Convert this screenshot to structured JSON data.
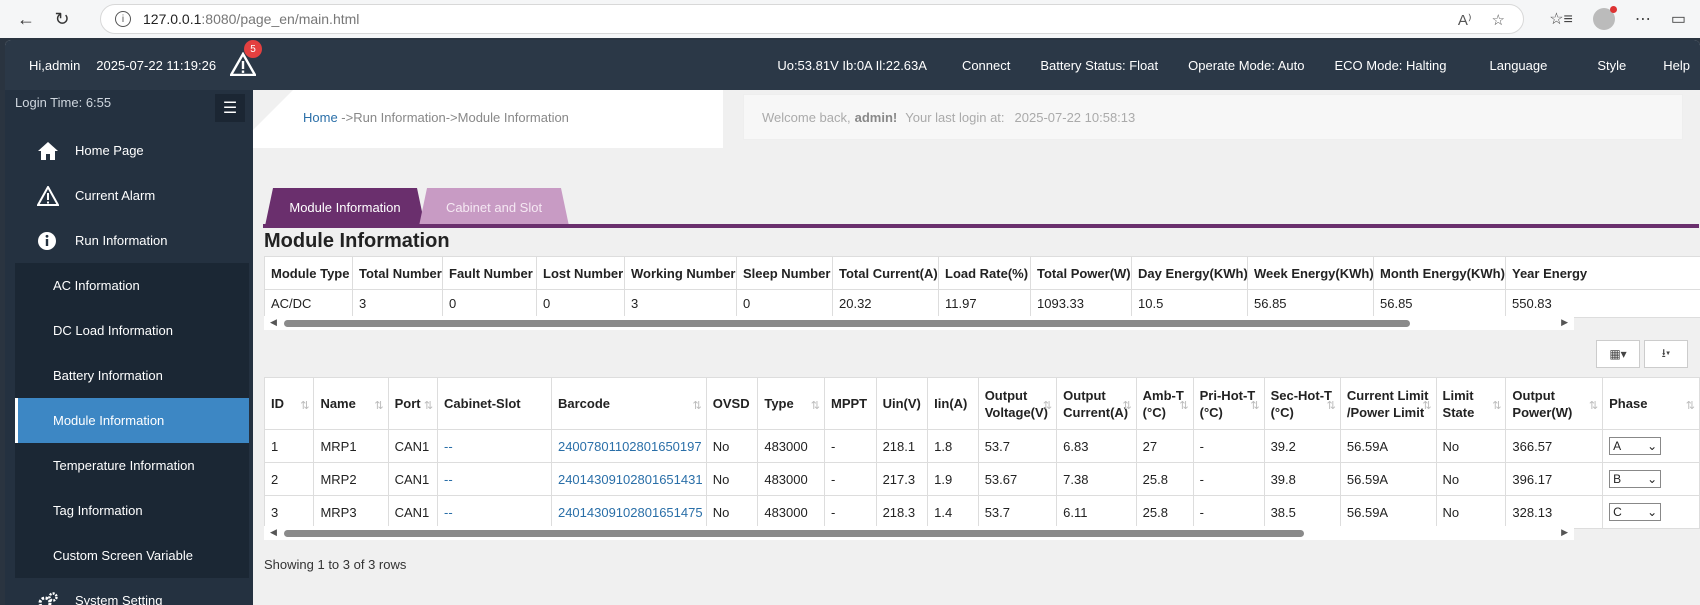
{
  "browser": {
    "url_host": "127.0.0.1",
    "url_rest": ":8080/page_en/main.html"
  },
  "topbar": {
    "greeting": "Hi,admin",
    "datetime": "2025-07-22 11:19:26",
    "alarm_count": "5",
    "readings": "Uo:53.81V Ib:0A Il:22.63A",
    "connect": "Connect",
    "battery_status": "Battery Status: Float",
    "operate_mode": "Operate Mode: Auto",
    "eco_mode": "ECO Mode: Halting",
    "language": "Language",
    "style": "Style",
    "help": "Help"
  },
  "sidebar": {
    "login_time": "Login Time:  6:55",
    "items": [
      {
        "label": "Home Page",
        "icon": "home-icon"
      },
      {
        "label": "Current Alarm",
        "icon": "warning-icon"
      },
      {
        "label": "Run Information",
        "icon": "info-icon"
      },
      {
        "label": "AC Information"
      },
      {
        "label": "DC Load Information"
      },
      {
        "label": "Battery Information"
      },
      {
        "label": "Module Information"
      },
      {
        "label": "Temperature Information"
      },
      {
        "label": "Tag Information"
      },
      {
        "label": "Custom Screen Variable"
      },
      {
        "label": "System Setting",
        "icon": "gears-icon"
      }
    ]
  },
  "breadcrumb": {
    "home": "Home",
    "rest": " ->Run Information->Module Information"
  },
  "welcome": {
    "prefix": "Welcome back,",
    "user": "admin!",
    "last_login_label": "Your last login at:",
    "last_login_time": "2025-07-22 10:58:13"
  },
  "tabs": [
    {
      "label": "Module Information"
    },
    {
      "label": "Cabinet and Slot"
    }
  ],
  "section_title": "Module Information",
  "summary": {
    "headers": [
      "Module Type",
      "Total Number",
      "Fault Number",
      "Lost Number",
      "Working Number",
      "Sleep Number",
      "Total Current(A)",
      "Load Rate(%)",
      "Total Power(W)",
      "Day Energy(KWh)",
      "Week Energy(KWh)",
      "Month Energy(KWh)",
      "Year Energy"
    ],
    "row": [
      "AC/DC",
      "3",
      "0",
      "0",
      "3",
      "0",
      "20.32",
      "11.97",
      "1093.33",
      "10.5",
      "56.85",
      "56.85",
      "550.83"
    ]
  },
  "modules": {
    "headers": [
      "ID",
      "Name",
      "Port",
      "Cabinet-Slot",
      "Barcode",
      "OVSD",
      "Type",
      "MPPT",
      "Uin(V)",
      "Iin(A)",
      "Output Voltage(V)",
      "Output Current(A)",
      "Amb-T (°C)",
      "Pri-Hot-T (°C)",
      "Sec-Hot-T (°C)",
      "Current Limit /Power Limit",
      "Limit State",
      "Output Power(W)",
      "Phase"
    ],
    "rows": [
      [
        "1",
        "MRP1",
        "CAN1",
        "--",
        "24007801102801650197",
        "No",
        "483000",
        "-",
        "218.1",
        "1.8",
        "53.7",
        "6.83",
        "27",
        "-",
        "39.2",
        "56.59A",
        "No",
        "366.57",
        "A"
      ],
      [
        "2",
        "MRP2",
        "CAN1",
        "--",
        "24014309102801651431",
        "No",
        "483000",
        "-",
        "217.3",
        "1.9",
        "53.67",
        "7.38",
        "25.8",
        "-",
        "39.8",
        "56.59A",
        "No",
        "396.17",
        "B"
      ],
      [
        "3",
        "MRP3",
        "CAN1",
        "--",
        "24014309102801651475",
        "No",
        "483000",
        "-",
        "218.3",
        "1.4",
        "53.7",
        "6.11",
        "25.8",
        "-",
        "38.5",
        "56.59A",
        "No",
        "328.13",
        "C"
      ]
    ]
  },
  "footer": "Showing 1 to 3 of 3 rows"
}
